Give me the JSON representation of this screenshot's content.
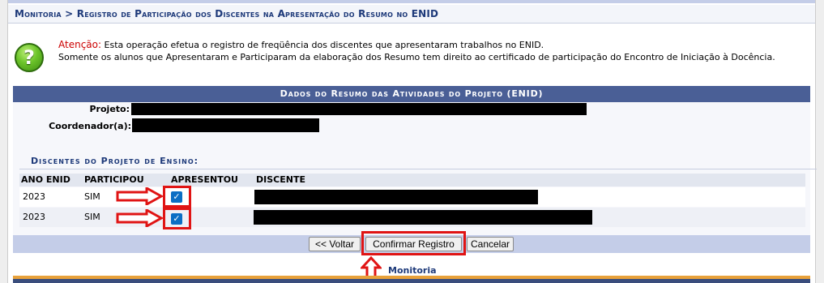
{
  "header": {
    "breadcrumb": "Monitoria > Registro de Participação dos Discentes na Apresentação do Resumo no ENID"
  },
  "notice": {
    "label": "Atenção:",
    "line1": " Esta operação efetua o registro de freqüência dos discentes que apresentaram trabalhos no ENID.",
    "line2": "Somente os alunos que Apresentaram e Participaram da elaboração dos Resumo tem direito ao certificado de participação do Encontro de Iniciação à Docência.",
    "icon": "help-question-icon"
  },
  "section": {
    "title": "Dados do Resumo das Atividades do Projeto (ENID)",
    "projeto_label": "Projeto:",
    "coordenador_label": "Coordenador(a):"
  },
  "students": {
    "title": "Discentes do Projeto de Ensino:",
    "columns": [
      "ANO ENID",
      "PARTICIPOU",
      "APRESENTOU",
      "DISCENTE"
    ],
    "rows": [
      {
        "ano": "2023",
        "participou": "SIM",
        "apresentou": true
      },
      {
        "ano": "2023",
        "participou": "SIM",
        "apresentou": true
      }
    ]
  },
  "buttons": {
    "voltar": "<< Voltar",
    "confirmar": "Confirmar Registro",
    "cancelar": "Cancelar"
  },
  "footer": {
    "link": "Monitoria"
  },
  "colors": {
    "annotation_red": "#e01414",
    "header_blue": "#4a5f96",
    "checkbox_blue": "#0b6ec4"
  }
}
